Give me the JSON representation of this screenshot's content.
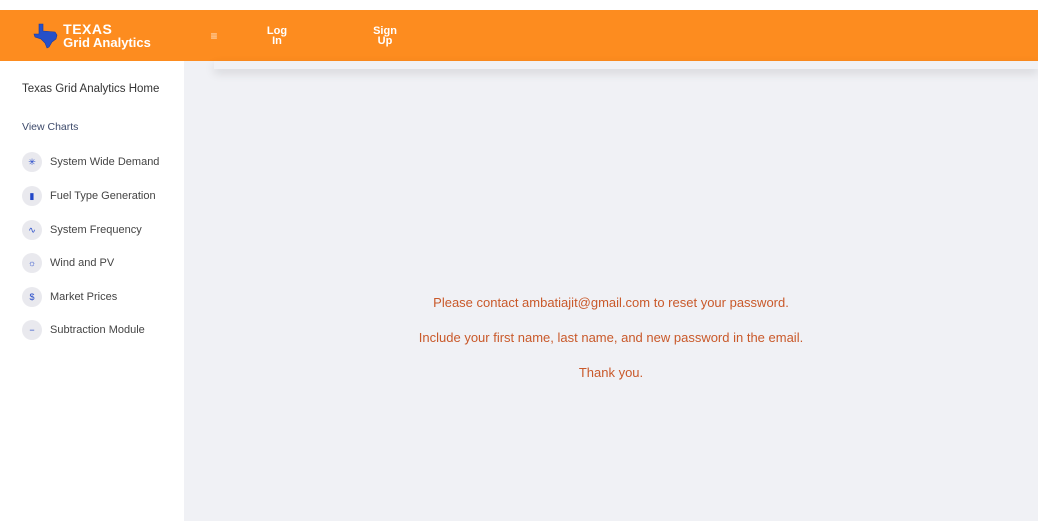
{
  "header": {
    "brand_line1": "TEXAS",
    "brand_line2": "Grid Analytics",
    "menu_icon": "hamburger-icon",
    "login_line1": "Log",
    "login_line2": "In",
    "signup_line1": "Sign",
    "signup_line2": "Up",
    "accent_color": "#fd8c1f"
  },
  "sidebar": {
    "home_label": "Texas Grid Analytics Home",
    "section_label": "View Charts",
    "items": [
      {
        "label": "System Wide Demand",
        "icon": "bulb-icon"
      },
      {
        "label": "Fuel Type Generation",
        "icon": "fuel-icon"
      },
      {
        "label": "System Frequency",
        "icon": "pulse-icon"
      },
      {
        "label": "Wind and PV",
        "icon": "sun-icon"
      },
      {
        "label": "Market Prices",
        "icon": "dollar-icon"
      },
      {
        "label": "Subtraction Module",
        "icon": "minus-icon"
      }
    ]
  },
  "main": {
    "line1": "Please contact ambatiajit@gmail.com to reset your password.",
    "line2": "Include your first name, last name, and new password in the email.",
    "line3": "Thank you.",
    "text_color": "#c9592a"
  }
}
